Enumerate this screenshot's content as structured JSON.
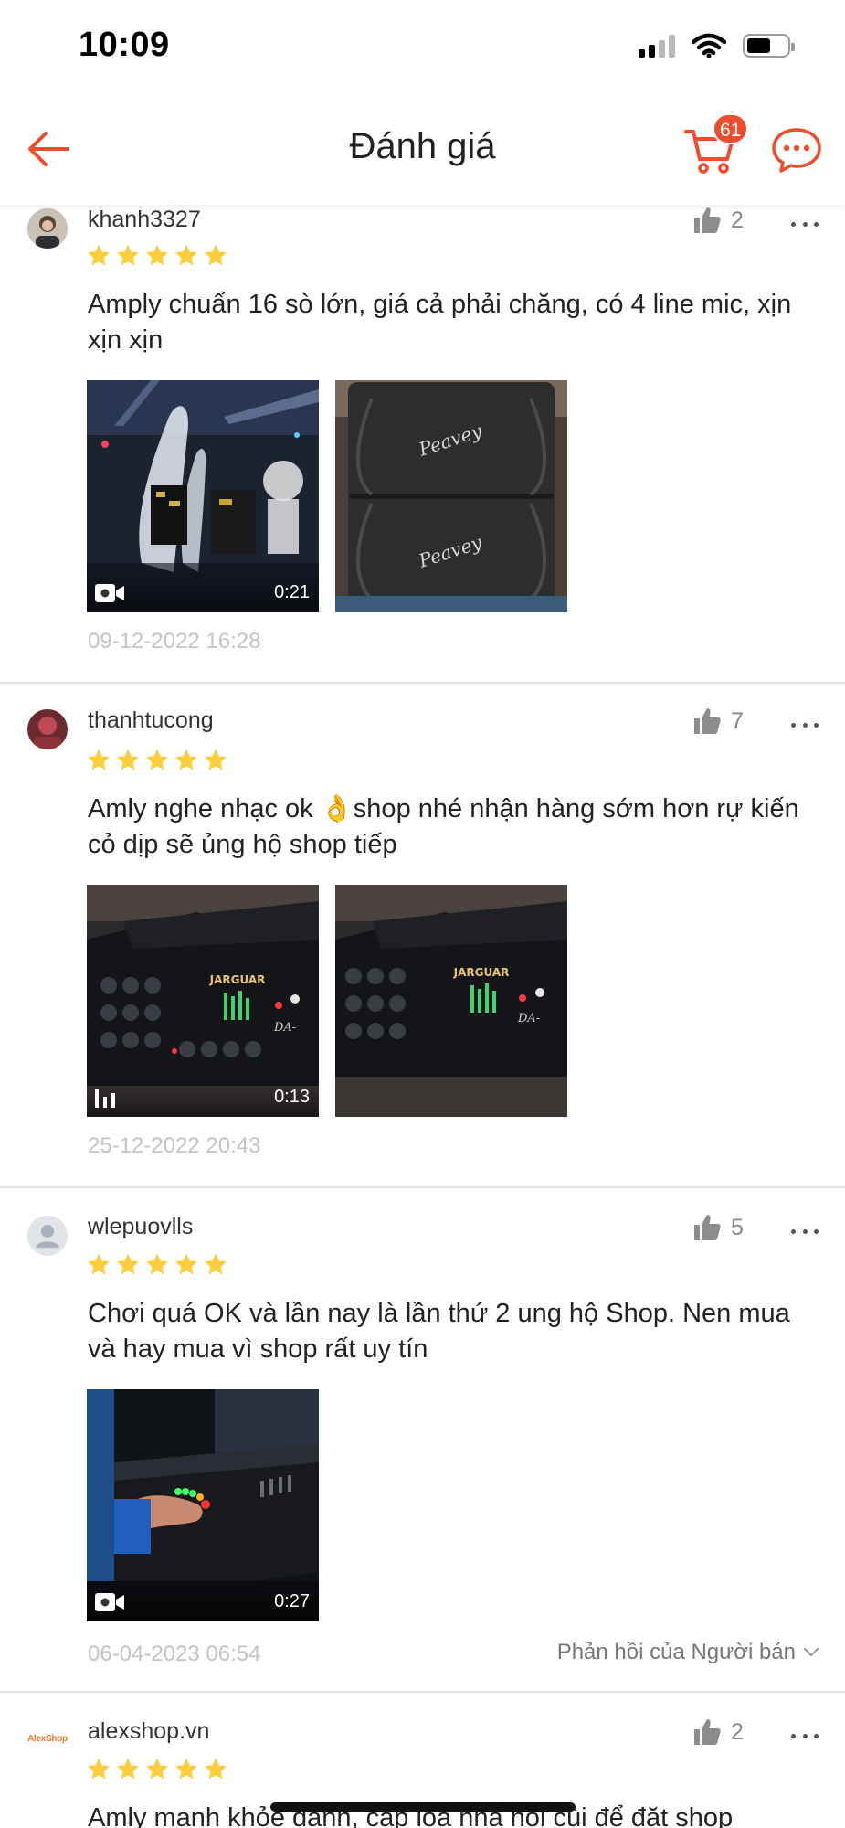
{
  "status_bar": {
    "time": "10:09"
  },
  "header": {
    "title": "Đánh giá",
    "cart_count": "61"
  },
  "colors": {
    "accent": "#ee4d2d",
    "star": "#ffce3d"
  },
  "reviews": [
    {
      "username": "khanh3327",
      "likes": "2",
      "rating": 5,
      "text": "Amply chuẩn 16 sò lớn, giá cả phải chăng, có 4 line mic, xịn xịn xịn",
      "media": [
        {
          "type": "video",
          "duration": "0:21"
        },
        {
          "type": "image"
        }
      ],
      "date": "09-12-2022 16:28"
    },
    {
      "username": "thanhtucong",
      "likes": "7",
      "rating": 5,
      "text": "Amly nghe nhạc ok 👌shop nhé nhận hàng sớm hơn rự kiến cỏ dịp sẽ ủng hộ shop tiếp",
      "media": [
        {
          "type": "audio-video",
          "duration": "0:13"
        },
        {
          "type": "image"
        }
      ],
      "date": "25-12-2022 20:43"
    },
    {
      "username": "wlepuovlls",
      "likes": "5",
      "rating": 5,
      "text": "Chơi quá OK và lần nay là lần thứ 2 ung hộ Shop. Nen mua và hay mua vì shop rất uy tín",
      "media": [
        {
          "type": "video",
          "duration": "0:27"
        }
      ],
      "date": "06-04-2023 06:54",
      "seller_reply": "Phản hồi của Người bán"
    },
    {
      "username": "alexshop.vn",
      "avatar_text": "AlexShop",
      "likes": "2",
      "rating": 5,
      "text": "Amly mạnh khỏe đanh, cặp loa nhà hỏi cùi để đặt shop"
    }
  ]
}
